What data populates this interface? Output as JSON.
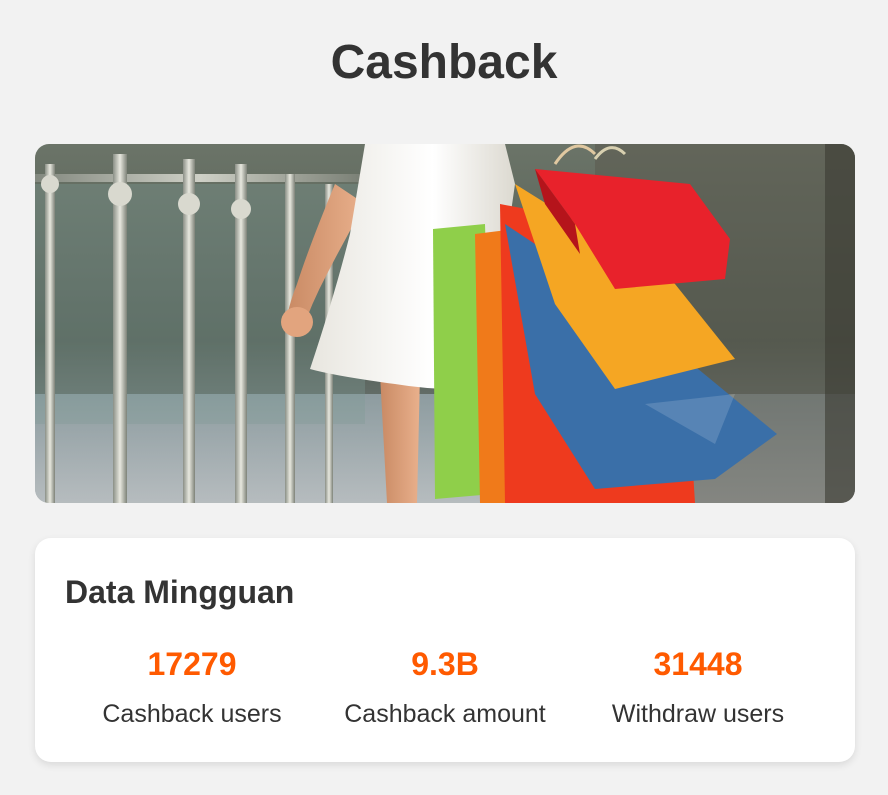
{
  "header": {
    "title": "Cashback"
  },
  "banner": {
    "image": "shopping-bags-photo"
  },
  "weekly_data": {
    "title": "Data Mingguan",
    "accent_color": "#ff5a00",
    "stats": [
      {
        "value": "17279",
        "label": "Cashback users"
      },
      {
        "value": "9.3B",
        "label": "Cashback amount"
      },
      {
        "value": "31448",
        "label": "Withdraw users"
      }
    ]
  }
}
